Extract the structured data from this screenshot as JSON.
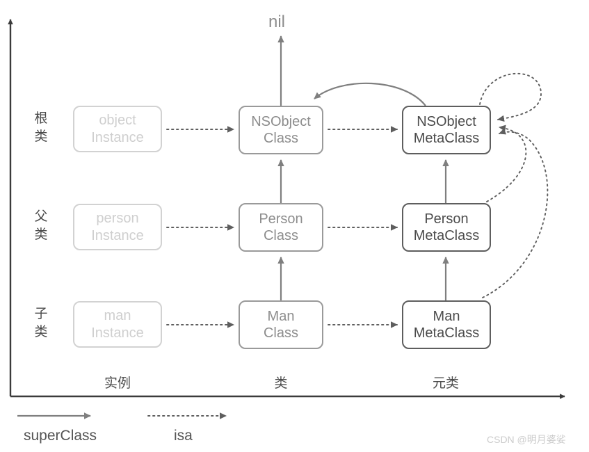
{
  "diagram": {
    "title_text": "nil",
    "axis": {
      "y_axis_name": "vertical-axis",
      "x_axis_name": "horizontal-axis"
    },
    "row_labels": [
      {
        "id": "root",
        "text": "根类",
        "chars": [
          "根",
          "类"
        ]
      },
      {
        "id": "parent",
        "text": "父类",
        "chars": [
          "父",
          "类"
        ]
      },
      {
        "id": "child",
        "text": "子类",
        "chars": [
          "子",
          "类"
        ]
      }
    ],
    "column_labels": [
      {
        "id": "instance",
        "text": "实例"
      },
      {
        "id": "class",
        "text": "类"
      },
      {
        "id": "metaclass",
        "text": "元类"
      }
    ],
    "nodes": {
      "object_instance": {
        "line1": "object",
        "line2": "Instance"
      },
      "person_instance": {
        "line1": "person",
        "line2": "Instance"
      },
      "man_instance": {
        "line1": "man",
        "line2": "Instance"
      },
      "nsobject_class": {
        "line1": "NSObject",
        "line2": "Class"
      },
      "person_class": {
        "line1": "Person",
        "line2": "Class"
      },
      "man_class": {
        "line1": "Man",
        "line2": "Class"
      },
      "nsobject_metaclass": {
        "line1": "NSObject",
        "line2": "MetaClass"
      },
      "person_metaclass": {
        "line1": "Person",
        "line2": "MetaClass"
      },
      "man_metaclass": {
        "line1": "Man",
        "line2": "MetaClass"
      }
    },
    "legend": [
      {
        "id": "superclass",
        "label": "superClass",
        "style": "solid"
      },
      {
        "id": "isa",
        "label": "isa",
        "style": "dotted"
      }
    ],
    "watermark": "CSDN @明月婆娑",
    "colors": {
      "instance_border": "#d2d2d2",
      "instance_text": "#cfcfcf",
      "class_border": "#9a9a9a",
      "class_text": "#8d8d8d",
      "meta_border": "#5e5e5e",
      "meta_text": "#4c4c4c",
      "axis": "#3b3b3b",
      "arrow_solid": "#7f7f7f",
      "arrow_dotted": "#5e5e5e",
      "label_text": "#4a4a4a",
      "watermark": "#cccccc"
    }
  }
}
